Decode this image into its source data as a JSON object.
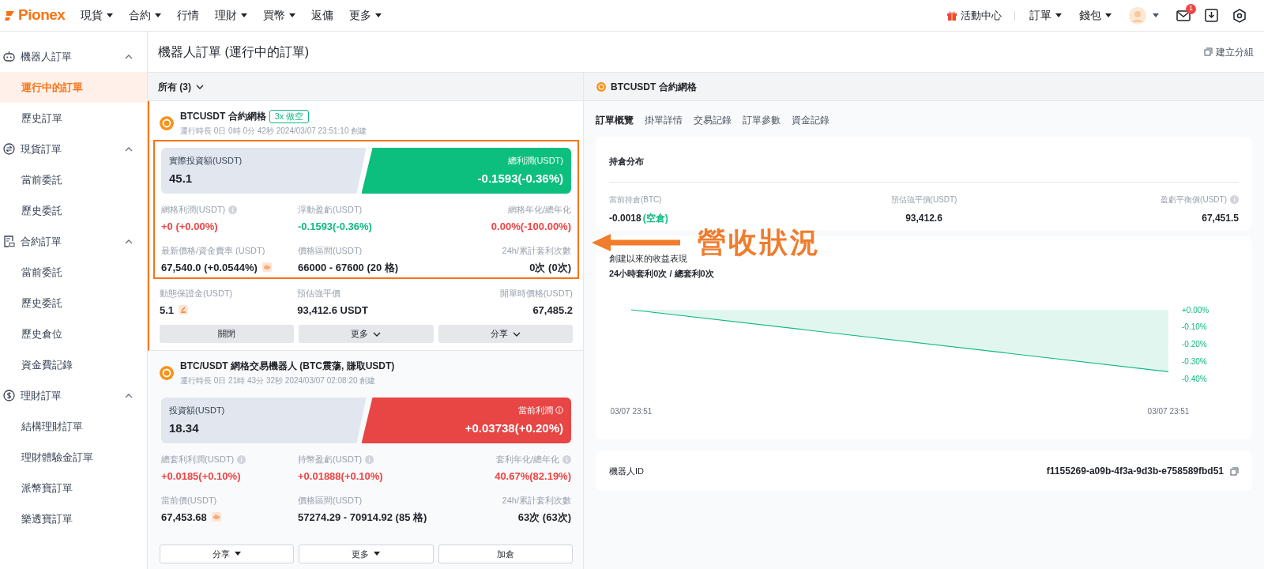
{
  "nav": {
    "logo": "Pionex",
    "menu": [
      {
        "label": "現貨",
        "dropdown": true
      },
      {
        "label": "合約",
        "dropdown": true
      },
      {
        "label": "行情",
        "dropdown": false
      },
      {
        "label": "理財",
        "dropdown": true
      },
      {
        "label": "買幣",
        "dropdown": true
      },
      {
        "label": "返傭",
        "dropdown": false
      },
      {
        "label": "更多",
        "dropdown": true
      }
    ],
    "promo": "活動中心",
    "right_menu": [
      {
        "label": "訂單",
        "dropdown": true
      },
      {
        "label": "錢包",
        "dropdown": true
      }
    ],
    "mail_badge": "1"
  },
  "sidebar": [
    {
      "label": "機器人訂單",
      "expanded": true,
      "children": [
        {
          "label": "運行中的訂單",
          "selected": true
        },
        {
          "label": "歷史訂單",
          "selected": false
        }
      ]
    },
    {
      "label": "現貨訂單",
      "expanded": true,
      "children": [
        {
          "label": "當前委託",
          "selected": false
        },
        {
          "label": "歷史委託",
          "selected": false
        }
      ]
    },
    {
      "label": "合約訂單",
      "expanded": true,
      "children": [
        {
          "label": "當前委託",
          "selected": false
        },
        {
          "label": "歷史委託",
          "selected": false
        },
        {
          "label": "歷史倉位",
          "selected": false
        },
        {
          "label": "資金費記錄",
          "selected": false
        }
      ]
    },
    {
      "label": "理財訂單",
      "expanded": true,
      "children": [
        {
          "label": "結構理財訂單",
          "selected": false
        },
        {
          "label": "理財體驗金訂單",
          "selected": false
        },
        {
          "label": "派幣寶訂單",
          "selected": false
        },
        {
          "label": "樂透寶訂單",
          "selected": false
        }
      ]
    }
  ],
  "page": {
    "title": "機器人訂單 (運行中的訂單)",
    "action": "建立分組"
  },
  "filter": "所有 (3)",
  "orders": [
    {
      "selected": true,
      "highlighted": true,
      "title": "BTCUSDT 合約網格",
      "tag": "3x 做空",
      "subtitle": "運行時長 0日 0時 0分 42秒 2024/03/07 23:51:10 創建",
      "investment": {
        "label": "實際投資額(USDT)",
        "value": "45.1"
      },
      "profit": {
        "label": "總利潤(USDT)",
        "value": "-0.1593(-0.36%)",
        "color": "#0dbf7f",
        "info": false
      },
      "stats": [
        {
          "label": "網格利潤(USDT)",
          "info": true,
          "value": "+0 (+0.00%)",
          "color": "#ef4444"
        },
        {
          "label": "浮動盈虧(USDT)",
          "info": false,
          "value": "-0.1593(-0.36%)",
          "color": "#10b981"
        },
        {
          "label": "網格年化/總年化",
          "info": false,
          "value": "0.00%(-100.00%)",
          "color": "#ef4444"
        },
        {
          "label": "最新價格/資金費率 (USDT)",
          "info": false,
          "value": "67,540.0 (+0.0544%)"
        },
        {
          "label": "價格區間(USDT)",
          "info": false,
          "value": "66000 - 67600 (20 格)"
        },
        {
          "label": "24h/累計套利次數",
          "info": false,
          "value": "0次 (0次)"
        }
      ],
      "extra_stats": [
        {
          "label": "動態保證金(USDT)",
          "info": false,
          "value": "5.1"
        },
        {
          "label": "預估強平價",
          "info": false,
          "value": "93,412.6 USDT"
        },
        {
          "label": "開單時價格(USDT)",
          "info": false,
          "value": "67,485.2"
        }
      ],
      "outlined": false,
      "buttons": [
        {
          "label": "關閉",
          "kind": "plain"
        },
        {
          "label": "更多",
          "kind": "chevron"
        },
        {
          "label": "分享",
          "kind": "chevron"
        }
      ]
    },
    {
      "selected": false,
      "highlighted": false,
      "title": "BTC/USDT 網格交易機器人 (BTC震蕩, 賺取USDT)",
      "subtitle": "運行時長 0日 21時 43分 32秒 2024/03/07 02:08:20 創建",
      "investment": {
        "label": "投資額(USDT)",
        "value": "18.34"
      },
      "profit": {
        "label": "當前利潤",
        "value": "+0.03738(+0.20%)",
        "color": "#e84545",
        "info": true
      },
      "stats": [
        {
          "label": "總套利利潤(USDT)",
          "info": true,
          "value": "+0.0185(+0.10%)",
          "color": "#ef4444"
        },
        {
          "label": "持幣盈虧(USDT)",
          "info": true,
          "value": "+0.01888(+0.10%)",
          "color": "#ef4444"
        },
        {
          "label": "套利年化/總年化",
          "info": true,
          "value": "40.67%(82.19%)",
          "color": "#ef4444"
        },
        {
          "label": "當前價(USDT)",
          "info": false,
          "value": "67,453.68"
        },
        {
          "label": "價格區間(USDT)",
          "info": false,
          "value": "57274.29 - 70914.92 (85 格)"
        },
        {
          "label": "24h/累計套利次數",
          "info": false,
          "value": "63次 (63次)"
        }
      ],
      "outlined": true,
      "buttons": [
        {
          "label": "分享",
          "kind": "triangle"
        },
        {
          "label": "更多",
          "kind": "triangle"
        },
        {
          "label": "加倉",
          "kind": "plain"
        }
      ]
    }
  ],
  "detail": {
    "title": "BTCUSDT 合約網格",
    "tabs": [
      {
        "label": "訂單概覽",
        "selected": true
      },
      {
        "label": "掛單詳情",
        "selected": false
      },
      {
        "label": "交易記錄",
        "selected": false
      },
      {
        "label": "訂單參數",
        "selected": false
      },
      {
        "label": "資金記錄",
        "selected": false
      }
    ],
    "position": {
      "title": "持倉分布",
      "stats": [
        {
          "label": "當前持倉(BTC)",
          "value": "-0.0018",
          "note": "(空倉)",
          "info": false
        },
        {
          "label": "預估強平價(USDT)",
          "value": "93,412.6",
          "info": false
        },
        {
          "label": "盈虧平衡價(USDT)",
          "value": "67,451.5",
          "info": true
        }
      ]
    },
    "performance": {
      "title": "創建以來的收益表現",
      "subtitle": "24小時套利0次 / 總套利0次",
      "chart_data": {
        "type": "area",
        "categories": [
          "03/07 23:51",
          "03/07 23:51"
        ],
        "series": [
          {
            "color": "#10b981",
            "values": [
              0,
              -0.36
            ]
          }
        ],
        "ylim": [
          -0.4,
          0
        ],
        "yticks": [
          {
            "value": 0,
            "label": "+0.00%"
          },
          {
            "value": -0.1,
            "label": "-0.10%"
          },
          {
            "value": -0.2,
            "label": "-0.20%"
          },
          {
            "value": -0.3,
            "label": "-0.30%"
          },
          {
            "value": -0.4,
            "label": "-0.40%"
          }
        ]
      }
    },
    "robot_id": {
      "label": "機器人ID",
      "value": "f1155269-a09b-4f3a-9d3b-e758589fbd51"
    }
  },
  "annotation": {
    "text": "營收狀況"
  }
}
